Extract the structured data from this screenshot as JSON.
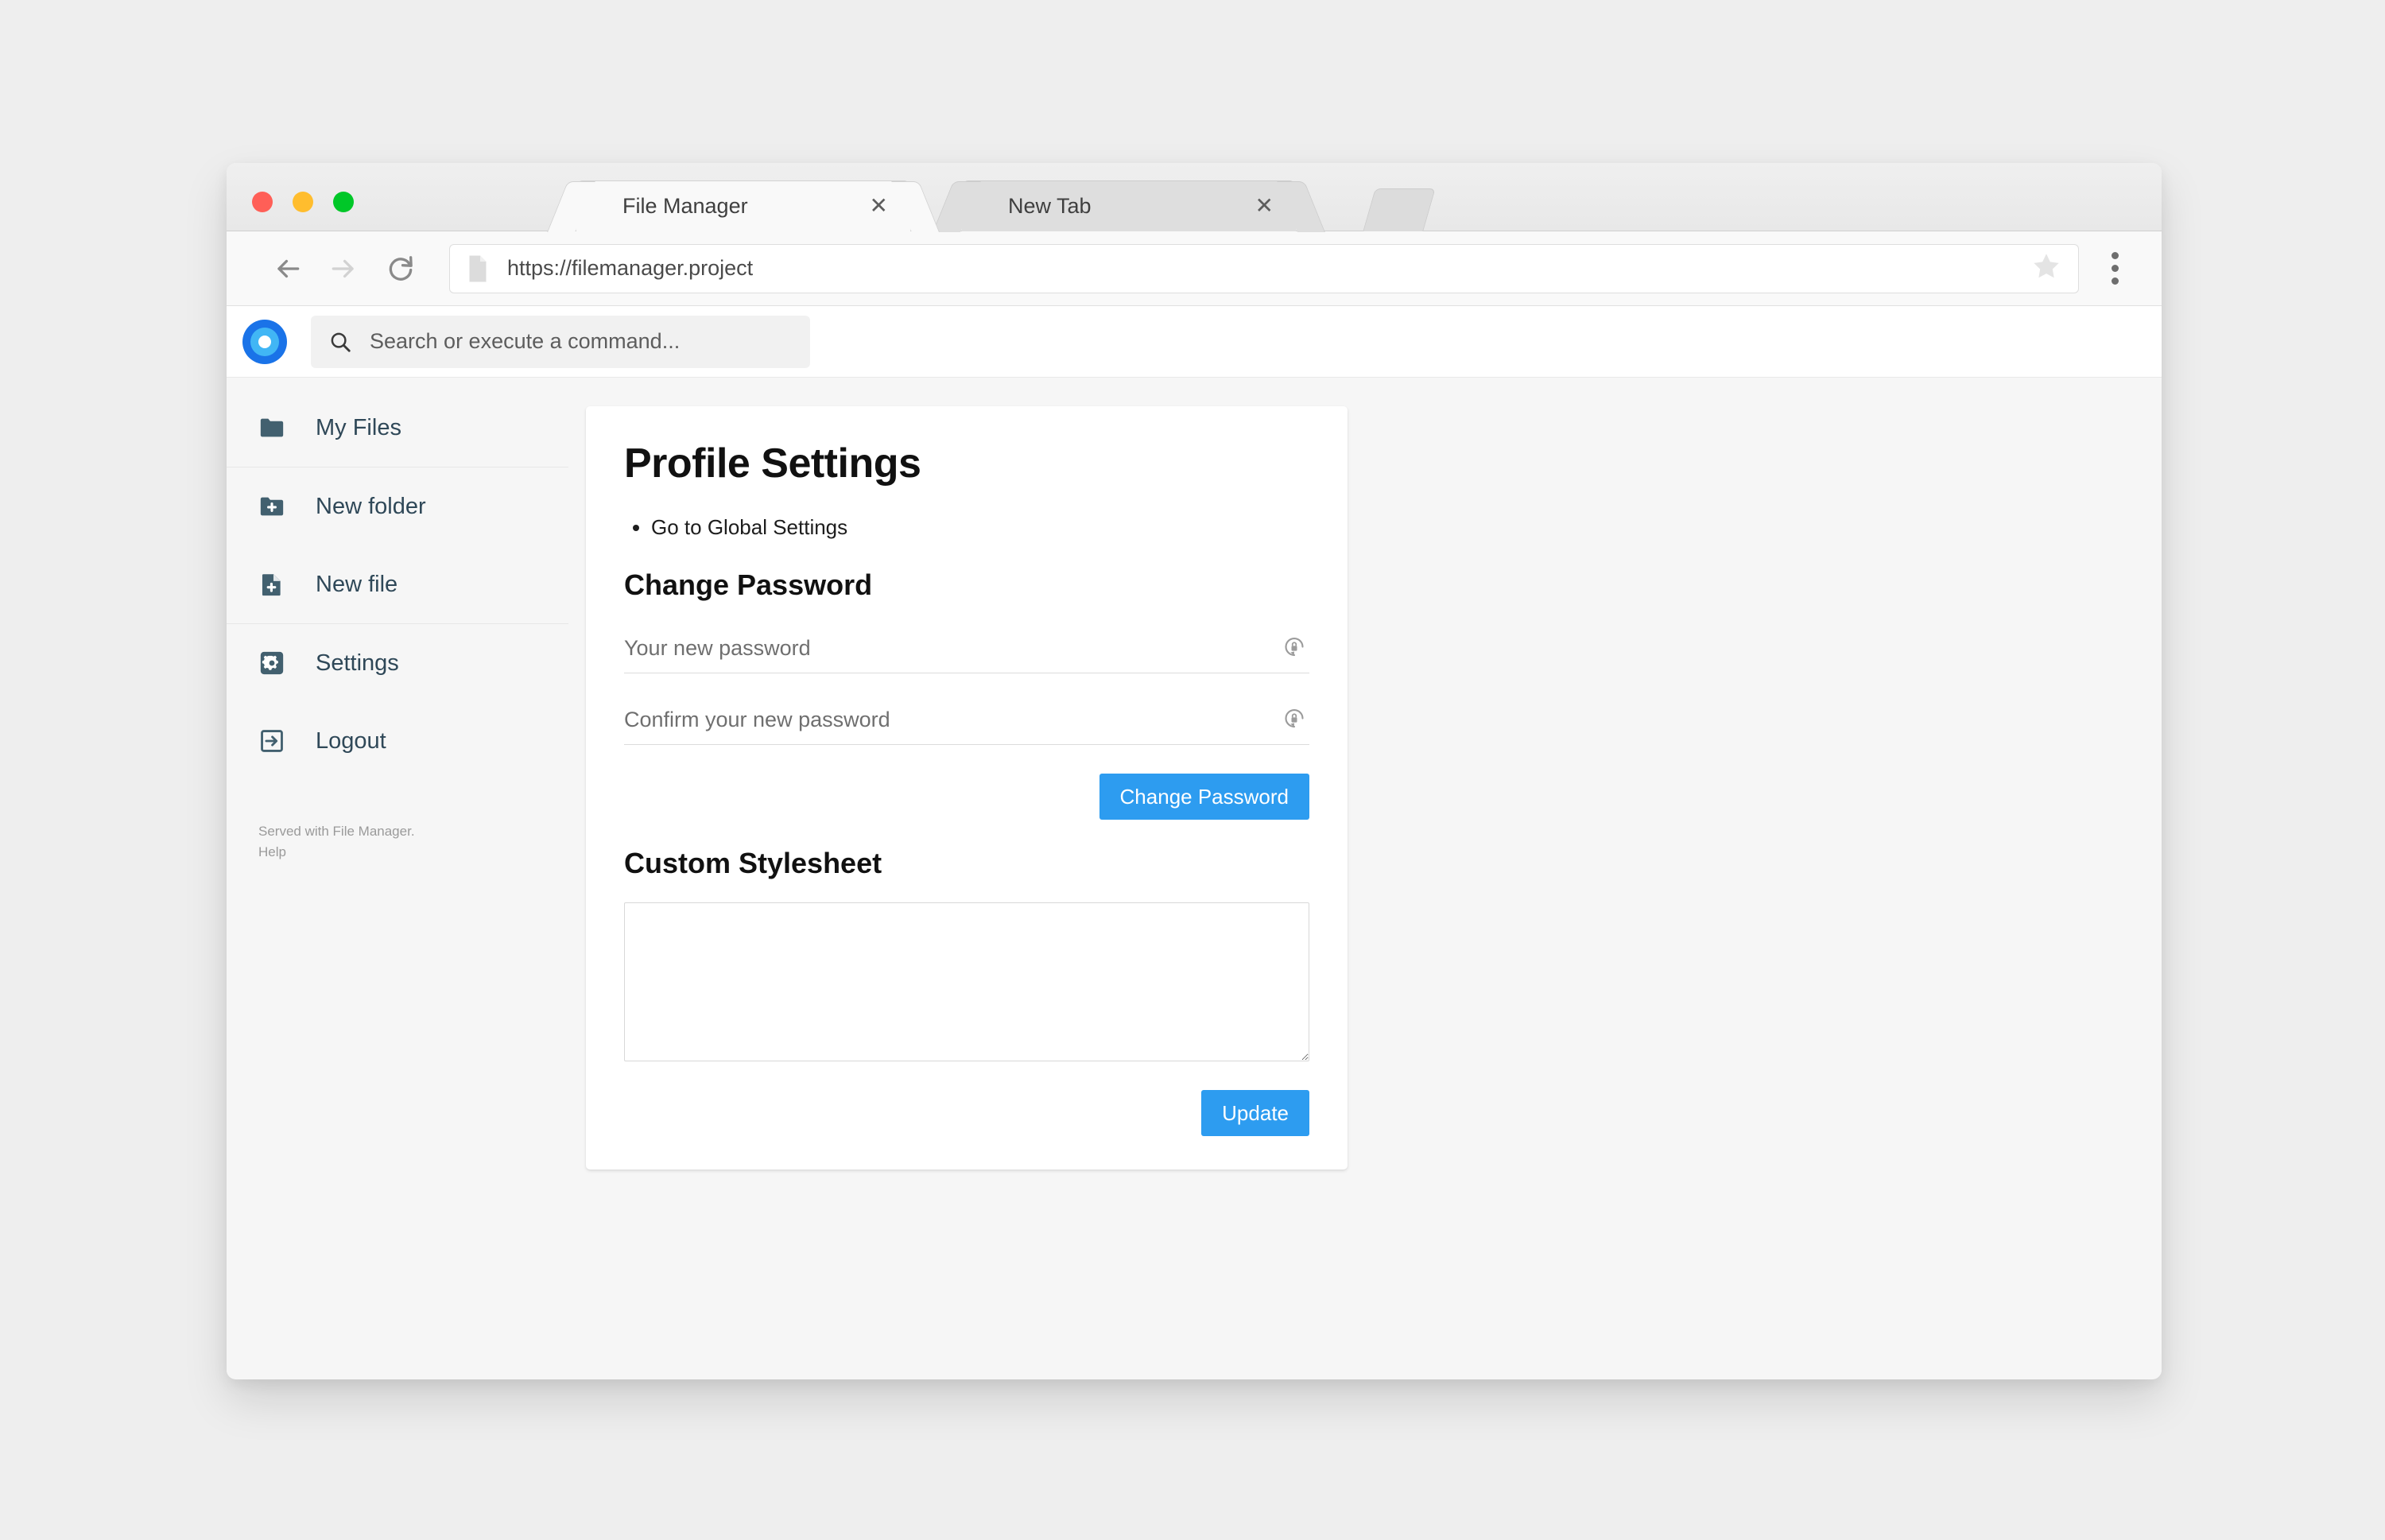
{
  "browser": {
    "traffic_lights": [
      {
        "name": "close",
        "color": "#ff5f57"
      },
      {
        "name": "minimize",
        "color": "#ffbd2e"
      },
      {
        "name": "maximize",
        "color": "#00c728"
      }
    ],
    "tabs": [
      {
        "title": "File Manager",
        "close_label": "✕",
        "active": true
      },
      {
        "title": "New Tab",
        "close_label": "✕",
        "active": false
      }
    ],
    "url": "https://filemanager.project"
  },
  "app": {
    "search": {
      "placeholder": "Search or execute a command...",
      "value": ""
    },
    "sidebar": {
      "groups": [
        {
          "items": [
            {
              "label": "My Files",
              "icon": "folder-icon"
            }
          ]
        },
        {
          "items": [
            {
              "label": "New folder",
              "icon": "folder-plus-icon"
            },
            {
              "label": "New file",
              "icon": "file-plus-icon"
            }
          ]
        },
        {
          "items": [
            {
              "label": "Settings",
              "icon": "gear-icon"
            },
            {
              "label": "Logout",
              "icon": "logout-icon"
            }
          ]
        }
      ],
      "footer": {
        "served_with": "Served with File Manager.",
        "help": "Help"
      }
    },
    "card": {
      "page_title": "Profile Settings",
      "links": [
        {
          "label": "Go to Global Settings"
        }
      ],
      "change_password": {
        "heading": "Change Password",
        "new_password": {
          "placeholder": "Your new password",
          "value": "",
          "icon": "generate-password-icon"
        },
        "confirm_password": {
          "placeholder": "Confirm your new password",
          "value": "",
          "icon": "generate-password-icon"
        },
        "submit_label": "Change Password"
      },
      "custom_stylesheet": {
        "heading": "Custom Stylesheet",
        "value": "",
        "placeholder": "",
        "submit_label": "Update"
      }
    }
  },
  "colors": {
    "accent": "#2d9cf0",
    "logo_outer": "#1a73e8",
    "logo_inner": "#41b6f5",
    "sidebar_icon": "#2f4858",
    "page_bg": "#eeeeee"
  }
}
